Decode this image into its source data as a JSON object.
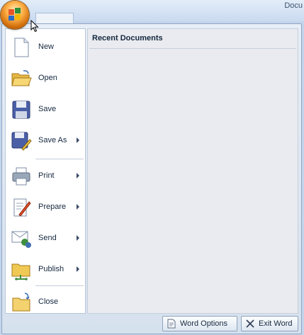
{
  "window": {
    "title": "Docu"
  },
  "menu": {
    "items": [
      {
        "label": "New",
        "has_submenu": false,
        "icon": "new-document-icon"
      },
      {
        "label": "Open",
        "has_submenu": false,
        "icon": "open-folder-icon"
      },
      {
        "label": "Save",
        "has_submenu": false,
        "icon": "floppy-disk-icon"
      },
      {
        "label": "Save As",
        "has_submenu": true,
        "icon": "save-as-icon"
      },
      {
        "label": "Print",
        "has_submenu": true,
        "icon": "printer-icon"
      },
      {
        "label": "Prepare",
        "has_submenu": true,
        "icon": "prepare-icon"
      },
      {
        "label": "Send",
        "has_submenu": true,
        "icon": "send-icon"
      },
      {
        "label": "Publish",
        "has_submenu": true,
        "icon": "publish-icon"
      },
      {
        "label": "Close",
        "has_submenu": false,
        "icon": "close-folder-icon"
      }
    ]
  },
  "recent": {
    "title": "Recent Documents"
  },
  "footer": {
    "options_label": "Word Options",
    "exit_label": "Exit Word"
  }
}
